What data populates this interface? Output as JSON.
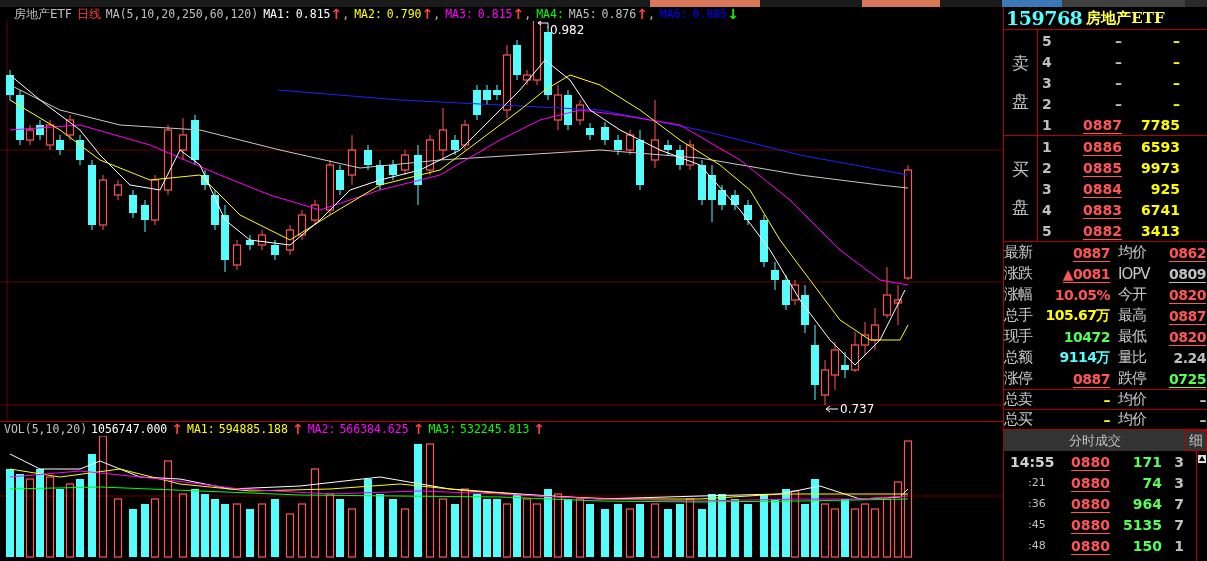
{
  "chart_header": {
    "name": "房地产ETF",
    "period": "日线",
    "indicator": "MA(5,10,20,250,60,120)",
    "ma": [
      {
        "label": "MA1:",
        "value": "0.815",
        "arrow": {
          "text": "↑",
          "color": "#ff4040"
        },
        "color": "#ffffff",
        "separator": ","
      },
      {
        "label": "MA2:",
        "value": "0.790",
        "arrow": {
          "text": "↑",
          "color": "#ff4040"
        },
        "color": "#ffff00",
        "separator": ","
      },
      {
        "label": "MA3:",
        "value": "0.815",
        "arrow": {
          "text": "↑",
          "color": "#ff4040"
        },
        "color": "#ff00ff",
        "separator": ","
      },
      {
        "label": "MA4:",
        "color": "#00ff00"
      },
      {
        "label": "MA5:",
        "value": "0.876",
        "arrow": {
          "text": "↑",
          "color": "#ff4040"
        },
        "color": "#c0c0c0",
        "separator": ","
      },
      {
        "label": "MA6:",
        "value": "0.885",
        "arrow": {
          "text": "↓",
          "color": "#00ff00"
        },
        "color": "#0000ff"
      }
    ]
  },
  "price_labels": {
    "high": "0.982",
    "low": "0.737"
  },
  "volume_header": {
    "indicator": "VOL(5,10,20)",
    "value": "1056747.000",
    "arrow": {
      "text": "↑",
      "color": "#ff4040"
    },
    "ma": [
      {
        "label": "MA1:",
        "value": "594885.188",
        "arrow": {
          "text": "↑",
          "color": "#ff4040"
        },
        "color": "#ffff00"
      },
      {
        "label": "MA2:",
        "value": "566384.625",
        "arrow": {
          "text": "↑",
          "color": "#ff4040"
        },
        "color": "#ff00ff"
      },
      {
        "label": "MA3:",
        "value": "532245.813",
        "arrow": {
          "text": "↑",
          "color": "#ff4040"
        },
        "color": "#00ff00"
      }
    ]
  },
  "quote_panel": {
    "code": "159768",
    "name": "房地产ETF",
    "ask_side": [
      "卖",
      "盘"
    ],
    "bid_side": [
      "买",
      "盘"
    ],
    "asks": [
      {
        "level": "5",
        "price": "–",
        "volume": "–",
        "active": false
      },
      {
        "level": "4",
        "price": "–",
        "volume": "–",
        "active": false
      },
      {
        "level": "3",
        "price": "–",
        "volume": "–",
        "active": false
      },
      {
        "level": "2",
        "price": "–",
        "volume": "–",
        "active": false
      },
      {
        "level": "1",
        "price": "0887",
        "volume": "7785",
        "active": true
      }
    ],
    "bids": [
      {
        "level": "1",
        "price": "0886",
        "volume": "6593",
        "active": true
      },
      {
        "level": "2",
        "price": "0885",
        "volume": "9973",
        "active": true
      },
      {
        "level": "3",
        "price": "0884",
        "volume": "925",
        "active": true
      },
      {
        "level": "4",
        "price": "0883",
        "volume": "6741",
        "active": true
      },
      {
        "level": "5",
        "price": "0882",
        "volume": "3413",
        "active": true
      }
    ],
    "stats": [
      {
        "left": {
          "label": "最新",
          "value": "0887",
          "color": "#ff5555",
          "underline": true
        },
        "right": {
          "label": "均价",
          "value": "0862",
          "color": "#ff5555",
          "underline": true
        }
      },
      {
        "left": {
          "label": "涨跌",
          "value": "▲0081",
          "color": "#ff5555",
          "underline": true
        },
        "right": {
          "label": "IOPV",
          "value": "0809",
          "color": "#c0c0c0",
          "underline": true
        }
      },
      {
        "left": {
          "label": "涨幅",
          "value": "10.05%",
          "color": "#ff5555",
          "underline": false
        },
        "right": {
          "label": "今开",
          "value": "0820",
          "color": "#ff5555",
          "underline": true
        }
      },
      {
        "left": {
          "label": "总手",
          "value": "105.67万",
          "color": "#ffff00",
          "underline": false
        },
        "right": {
          "label": "最高",
          "value": "0887",
          "color": "#ff5555",
          "underline": true
        }
      },
      {
        "left": {
          "label": "现手",
          "value": "10472",
          "color": "#55ff55",
          "underline": false
        },
        "right": {
          "label": "最低",
          "value": "0820",
          "color": "#ff5555",
          "underline": true
        }
      },
      {
        "left": {
          "label": "总额",
          "value": "9114万",
          "color": "#55ffff",
          "underline": false
        },
        "right": {
          "label": "量比",
          "value": "2.24",
          "color": "#c0c0c0",
          "underline": false
        }
      },
      {
        "left": {
          "label": "涨停",
          "value": "0887",
          "color": "#ff5555",
          "underline": true
        },
        "right": {
          "label": "跌停",
          "value": "0725",
          "color": "#55ff55",
          "underline": true
        }
      }
    ],
    "totals": [
      {
        "label": "总卖",
        "value": "–",
        "label2": "均价",
        "value2": "–"
      },
      {
        "label": "总买",
        "value": "–",
        "label2": "均价",
        "value2": "–"
      }
    ],
    "trades_tab": "分时成交",
    "detail_tab": "细",
    "trades": [
      {
        "time": "14:55",
        "kind": "full",
        "price": "0880",
        "volume": "171",
        "count": "3"
      },
      {
        "time": ":21",
        "kind": "second",
        "price": "0880",
        "volume": "74",
        "count": "3"
      },
      {
        "time": ":36",
        "kind": "second",
        "price": "0880",
        "volume": "964",
        "count": "7"
      },
      {
        "time": ":45",
        "kind": "second",
        "price": "0880",
        "volume": "5135",
        "count": "7"
      },
      {
        "time": ":48",
        "kind": "second",
        "price": "0880",
        "volume": "150",
        "count": "1"
      }
    ]
  }
}
